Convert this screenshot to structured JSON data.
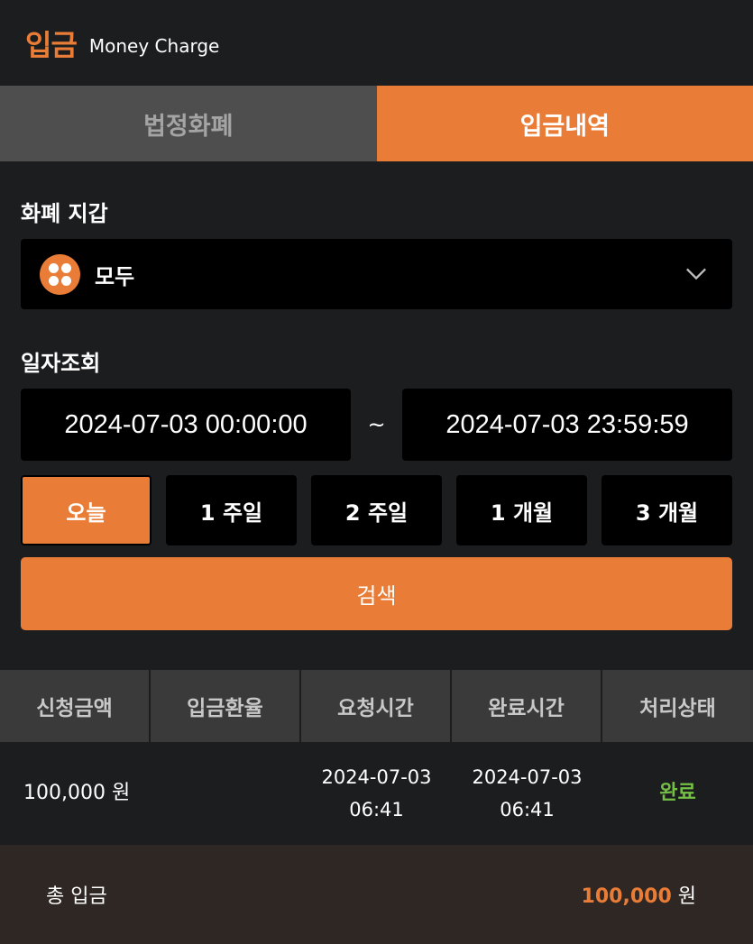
{
  "header": {
    "title": "입금",
    "subtitle": "Money Charge"
  },
  "tabs": [
    {
      "label": "법정화폐",
      "active": false
    },
    {
      "label": "입금내역",
      "active": true
    }
  ],
  "wallet": {
    "label": "화폐 지갑",
    "selected": "모두",
    "icon": "grid-dots-icon"
  },
  "date_query": {
    "label": "일자조회",
    "start": "2024-07-03 00:00:00",
    "separator": "~",
    "end": "2024-07-03 23:59:59"
  },
  "periods": [
    {
      "label": "오늘",
      "active": true
    },
    {
      "label": "1 주일",
      "active": false
    },
    {
      "label": "2 주일",
      "active": false
    },
    {
      "label": "1 개월",
      "active": false
    },
    {
      "label": "3 개월",
      "active": false
    }
  ],
  "search_label": "검색",
  "table": {
    "headers": [
      "신청금액",
      "입금환율",
      "요청시간",
      "완료시간",
      "처리상태"
    ],
    "rows": [
      {
        "amount": "100,000 원",
        "rate": "",
        "request_date": "2024-07-03",
        "request_time": "06:41",
        "complete_date": "2024-07-03",
        "complete_time": "06:41",
        "status": "완료"
      }
    ]
  },
  "footer": {
    "label": "총 입금",
    "total": "100,000",
    "unit": "원"
  },
  "colors": {
    "accent": "#e97d37",
    "success": "#74c044",
    "background": "#1c1d1f"
  }
}
